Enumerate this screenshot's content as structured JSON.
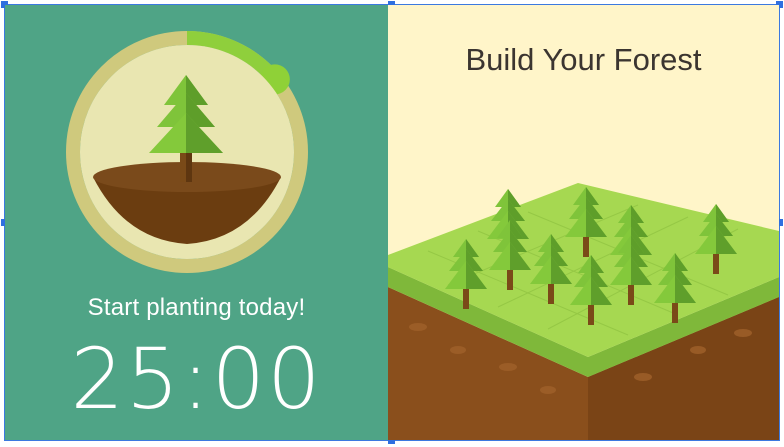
{
  "left_panel": {
    "tagline": "Start planting today!",
    "timer": "25:00",
    "progress_fraction": 0.14,
    "colors": {
      "background": "#4fa486",
      "ring": "#cfc97d",
      "progress": "#8fcf3c",
      "soil": "#6b3d10"
    }
  },
  "right_panel": {
    "title": "Build Your Forest",
    "colors": {
      "background": "#fff5c9",
      "grass": "#9ed24a",
      "soil": "#8a4f1c"
    }
  },
  "icons": {
    "timer_tree": "pine-tree-icon",
    "forest": "isometric-forest-icon"
  }
}
